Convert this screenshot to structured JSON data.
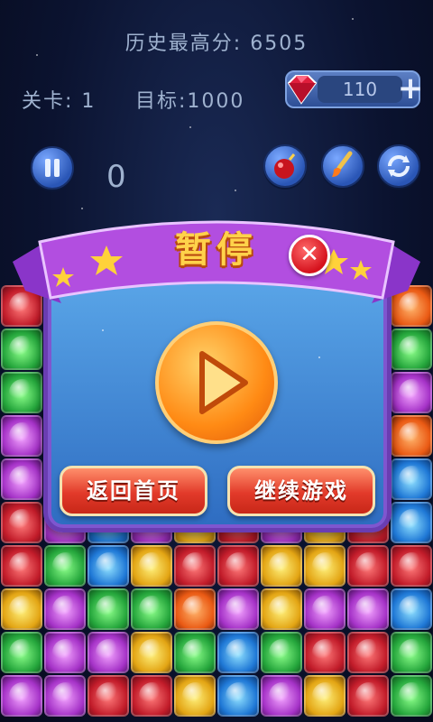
{
  "hud": {
    "high_score_text": "历史最高分: 6505",
    "level_text": "关卡: 1",
    "target_text": "目标:1000",
    "score": "0",
    "gem_count": "110"
  },
  "dialog": {
    "title": "暂停",
    "home_label": "返回首页",
    "continue_label": "继续游戏"
  },
  "colors": {
    "panel_border": "#6a3db2",
    "panel_fill": "#3b86d6",
    "title_text": "#ffd24a",
    "button_red": "#e23a2a",
    "play_orange": "#ff8a14"
  },
  "board": {
    "rows": [
      [
        "red",
        "purple",
        "purple",
        "red",
        "yellow",
        "blue",
        "green",
        "red",
        "purple",
        "orange"
      ],
      [
        "green",
        "purple",
        "green",
        "purple",
        "purple",
        "blue",
        "yellow",
        "green",
        "purple",
        "green"
      ],
      [
        "green",
        "yellow",
        "yellow",
        "purple",
        "green",
        "green",
        "purple",
        "red",
        "red",
        "purple"
      ],
      [
        "purple",
        "orange",
        "green",
        "blue",
        "purple",
        "red",
        "blue",
        "yellow",
        "purple",
        "orange"
      ],
      [
        "purple",
        "green",
        "purple",
        "yellow",
        "green",
        "orange",
        "red",
        "green",
        "blue",
        "blue"
      ],
      [
        "red",
        "purple",
        "blue",
        "purple",
        "yellow",
        "red",
        "purple",
        "yellow",
        "red",
        "blue"
      ],
      [
        "red",
        "green",
        "blue",
        "yellow",
        "red",
        "red",
        "yellow",
        "yellow",
        "red",
        "red"
      ],
      [
        "yellow",
        "purple",
        "green",
        "green",
        "orange",
        "purple",
        "yellow",
        "purple",
        "purple",
        "blue"
      ],
      [
        "green",
        "purple",
        "purple",
        "yellow",
        "green",
        "blue",
        "green",
        "red",
        "red",
        "green"
      ],
      [
        "purple",
        "purple",
        "red",
        "red",
        "yellow",
        "blue",
        "purple",
        "yellow",
        "red",
        "green"
      ]
    ]
  }
}
